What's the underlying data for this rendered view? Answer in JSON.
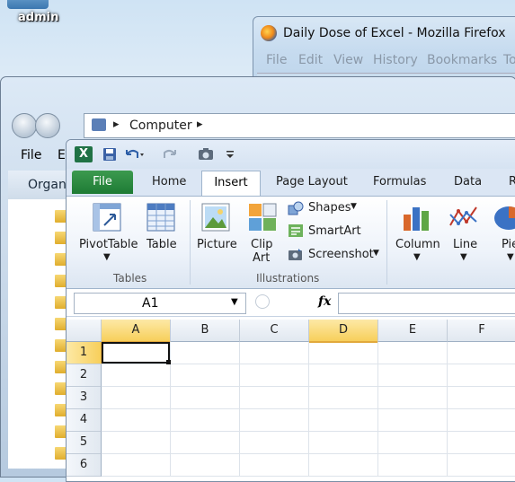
{
  "desktop": {
    "admin_label": "admin"
  },
  "firefox": {
    "title": "Daily Dose of Excel - Mozilla Firefox",
    "menu": [
      "File",
      "Edit",
      "View",
      "History",
      "Bookmarks",
      "To"
    ]
  },
  "explorer": {
    "address": "Computer",
    "menu": {
      "file": "File",
      "edit": "E"
    },
    "organize": "Organ"
  },
  "excel": {
    "tabs": {
      "file": "File",
      "home": "Home",
      "insert": "Insert",
      "page_layout": "Page Layout",
      "formulas": "Formulas",
      "data": "Data",
      "more": "R"
    },
    "ribbon": {
      "pivottable": "PivotTable",
      "table": "Table",
      "picture": "Picture",
      "clip_art_1": "Clip",
      "clip_art_2": "Art",
      "shapes": "Shapes",
      "smartart": "SmartArt",
      "screenshot": "Screenshot",
      "column": "Column",
      "line": "Line",
      "pie": "Pie"
    },
    "groups": {
      "tables": "Tables",
      "illustrations": "Illustrations"
    },
    "name_box": "A1",
    "fx": "fx",
    "columns": [
      "A",
      "B",
      "C",
      "D",
      "E",
      "F"
    ],
    "rows": [
      "1",
      "2",
      "3",
      "4",
      "5",
      "6"
    ]
  }
}
